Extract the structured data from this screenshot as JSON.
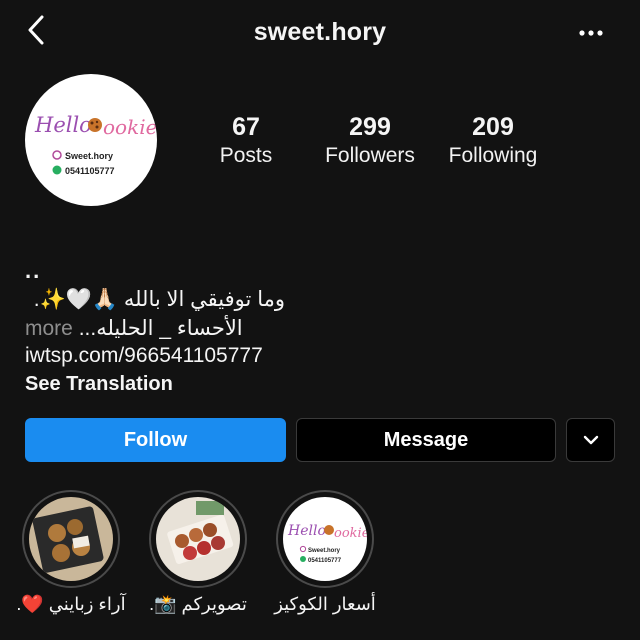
{
  "header": {
    "username": "sweet.hory"
  },
  "profile": {
    "avatar_logo": "Hello Cookie",
    "avatar_handle": "Sweet.hory",
    "avatar_phone": "0541105777"
  },
  "stats": [
    {
      "value": "67",
      "label": "Posts"
    },
    {
      "value": "299",
      "label": "Followers"
    },
    {
      "value": "209",
      "label": "Following"
    }
  ],
  "bio": {
    "dots": "..",
    "line1": "وما توفيقي الا بالله 🙏🏻🤍✨.",
    "line2": "الأحساء _ الحليله...",
    "more": "more",
    "link": "iwtsp.com/966541105777",
    "translate": "See Translation"
  },
  "actions": {
    "follow": "Follow",
    "message": "Message"
  },
  "highlights": [
    {
      "label": "آراء زبايني ❤️.",
      "cover": "cookies-box"
    },
    {
      "label": "تصويركم 📸.",
      "cover": "cookie-tray"
    },
    {
      "label": "أسعار الكوكيز",
      "cover": "hello-cookie-logo"
    }
  ],
  "colors": {
    "background": "#121212",
    "follow_button": "#1a8cf0",
    "logo_purple": "#9b4fb0",
    "logo_pink": "#e06aa0"
  },
  "icons": {
    "back": "chevron-left-icon",
    "menu": "more-horizontal-icon",
    "dropdown": "chevron-down-icon"
  }
}
